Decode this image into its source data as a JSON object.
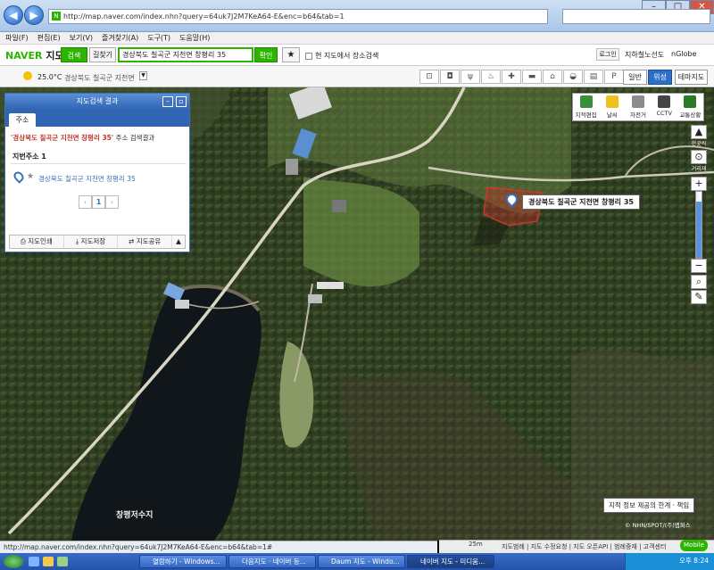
{
  "browser": {
    "url": "http://map.naver.com/index.nhn?query=64uk7J2M7KeA64-E&enc=b64&tab=1",
    "search_placeholder": "",
    "window_controls": [
      "–",
      "□",
      "✕"
    ]
  },
  "menu": [
    "파일(F)",
    "편집(E)",
    "보기(V)",
    "즐겨찾기(A)",
    "도구(T)",
    "도움말(H)"
  ],
  "naver": {
    "logo_brand": "NAVER",
    "logo_suffix": " 지도",
    "search_label": "검색",
    "route_label": "길찾기",
    "query": "경상북도 칠곡군 지천면 창평리 35",
    "confirm_label": "확인",
    "star": "★",
    "current_map_search": "현 지도에서 장소검색",
    "login": "로그인",
    "subway": "지하철노선도",
    "nglobe": "nGlobe"
  },
  "weather": {
    "temp": "25.0°C",
    "location": "경상북도 칠곡군 지천면"
  },
  "view_buttons": [
    "일반",
    "위성",
    "테마지도"
  ],
  "result_panel": {
    "title": "지도검색 결과",
    "tab": "주소",
    "result_query": "'경상북도 칠곡군 지천면 창평리 35'",
    "result_suffix": " 주소 검색결과",
    "lot_label": "지번주소 1",
    "address": "경상북도 칠곡군 지천면 창평리 35",
    "page_prev": "‹",
    "page_current": "1",
    "page_next": "›",
    "buttons": [
      "지도인쇄",
      "지도저장",
      "지도공유"
    ]
  },
  "right_tools": [
    "지적편집도",
    "날씨",
    "자전거",
    "CCTV",
    "교통상황"
  ],
  "zoom": {
    "up": "▲",
    "right_tool_1": "한곳씩",
    "right_tool_2": "거리재",
    "plus": "+",
    "minus": "−"
  },
  "map_labels": {
    "marker": "경상북도 칠곡군 지천면 창평리 35",
    "lake": "창평저수지",
    "notice": "지적 정보 제공의 한계 · 책임",
    "copyright": "© NHN/SPOT/(주)맵퍼스",
    "scale": "25m",
    "footer": "지도범례 | 지도 수정요청 | 지도 오픈API | 범례중재 | 고객센터",
    "mobile": "Mobile"
  },
  "status_url": "http://map.naver.com/index.nhn?query=64uk7J2M7KeA64-E&enc=b64&tab=1#",
  "taskbar": {
    "items": [
      "열람하기 - Windows...",
      "다음지도 · 네이버 등...",
      "Daum 지도 - Windo...",
      "네이버 지도 - 미디움..."
    ],
    "clock": "오후 8:24"
  }
}
